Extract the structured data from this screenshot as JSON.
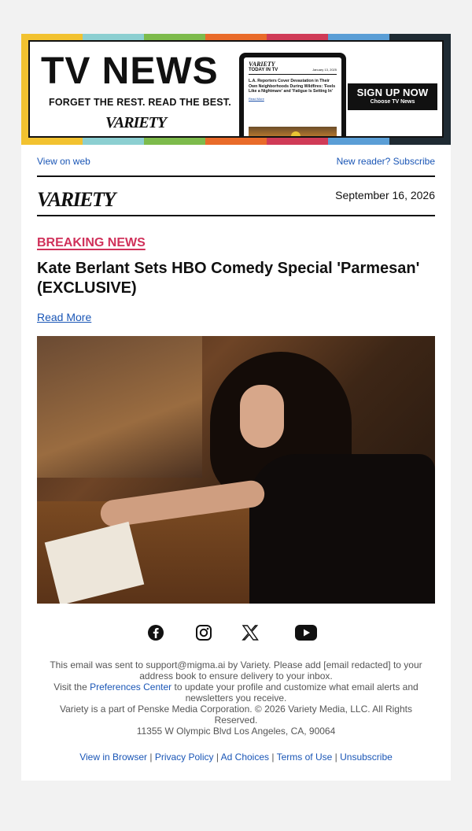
{
  "banner": {
    "title": "TV NEWS",
    "tagline": "FORGET THE REST. READ THE BEST.",
    "logo": "VARIETY",
    "tablet": {
      "logo": "VARIETY",
      "section": "TODAY IN TV",
      "date": "January 13, 2025",
      "story": "L.A. Reporters Cover Devastation in Their Own Neighborhoods During Wildfires: 'Feels Like a Nightmare' and 'Fatigue Is Setting In'",
      "read_more": "Read More"
    },
    "cta_title": "SIGN UP NOW",
    "cta_sub": "Choose TV News",
    "stripe_colors": [
      "#f2c230",
      "#8ccfd1",
      "#7dbb4c",
      "#e96b2a",
      "#d03b57",
      "#5a9ed6",
      "#1f2b33"
    ]
  },
  "top_links": {
    "view_on_web": "View on web",
    "subscribe": "New reader? Subscribe"
  },
  "header": {
    "logo": "VARIETY",
    "date": "September 16, 2026"
  },
  "article": {
    "kicker": "BREAKING NEWS",
    "headline": "Kate Berlant Sets HBO Comedy Special 'Parmesan' (EXCLUSIVE)",
    "read_more": "Read More"
  },
  "social": {
    "icons": [
      "facebook-icon",
      "instagram-icon",
      "x-icon",
      "youtube-icon"
    ]
  },
  "footer": {
    "line1": "This email was sent to support@migma.ai by Variety. Please add [email redacted] to your address book to ensure delivery to your inbox.",
    "line2_pre": "Visit the ",
    "line2_link": "Preferences Center",
    "line2_post": " to update your profile and customize what email alerts and newsletters you receive.",
    "line3": "Variety is a part of Penske Media Corporation. © 2026 Variety Media, LLC. All Rights Reserved.",
    "line4": "11355 W Olympic Blvd Los Angeles, CA, 90064",
    "links": [
      "View in Browser",
      "Privacy Policy",
      "Ad Choices",
      "Terms of Use",
      "Unsubscribe"
    ],
    "separator": "|"
  },
  "colors": {
    "accent_pink": "#d0315a",
    "link_blue": "#1a56b6"
  }
}
